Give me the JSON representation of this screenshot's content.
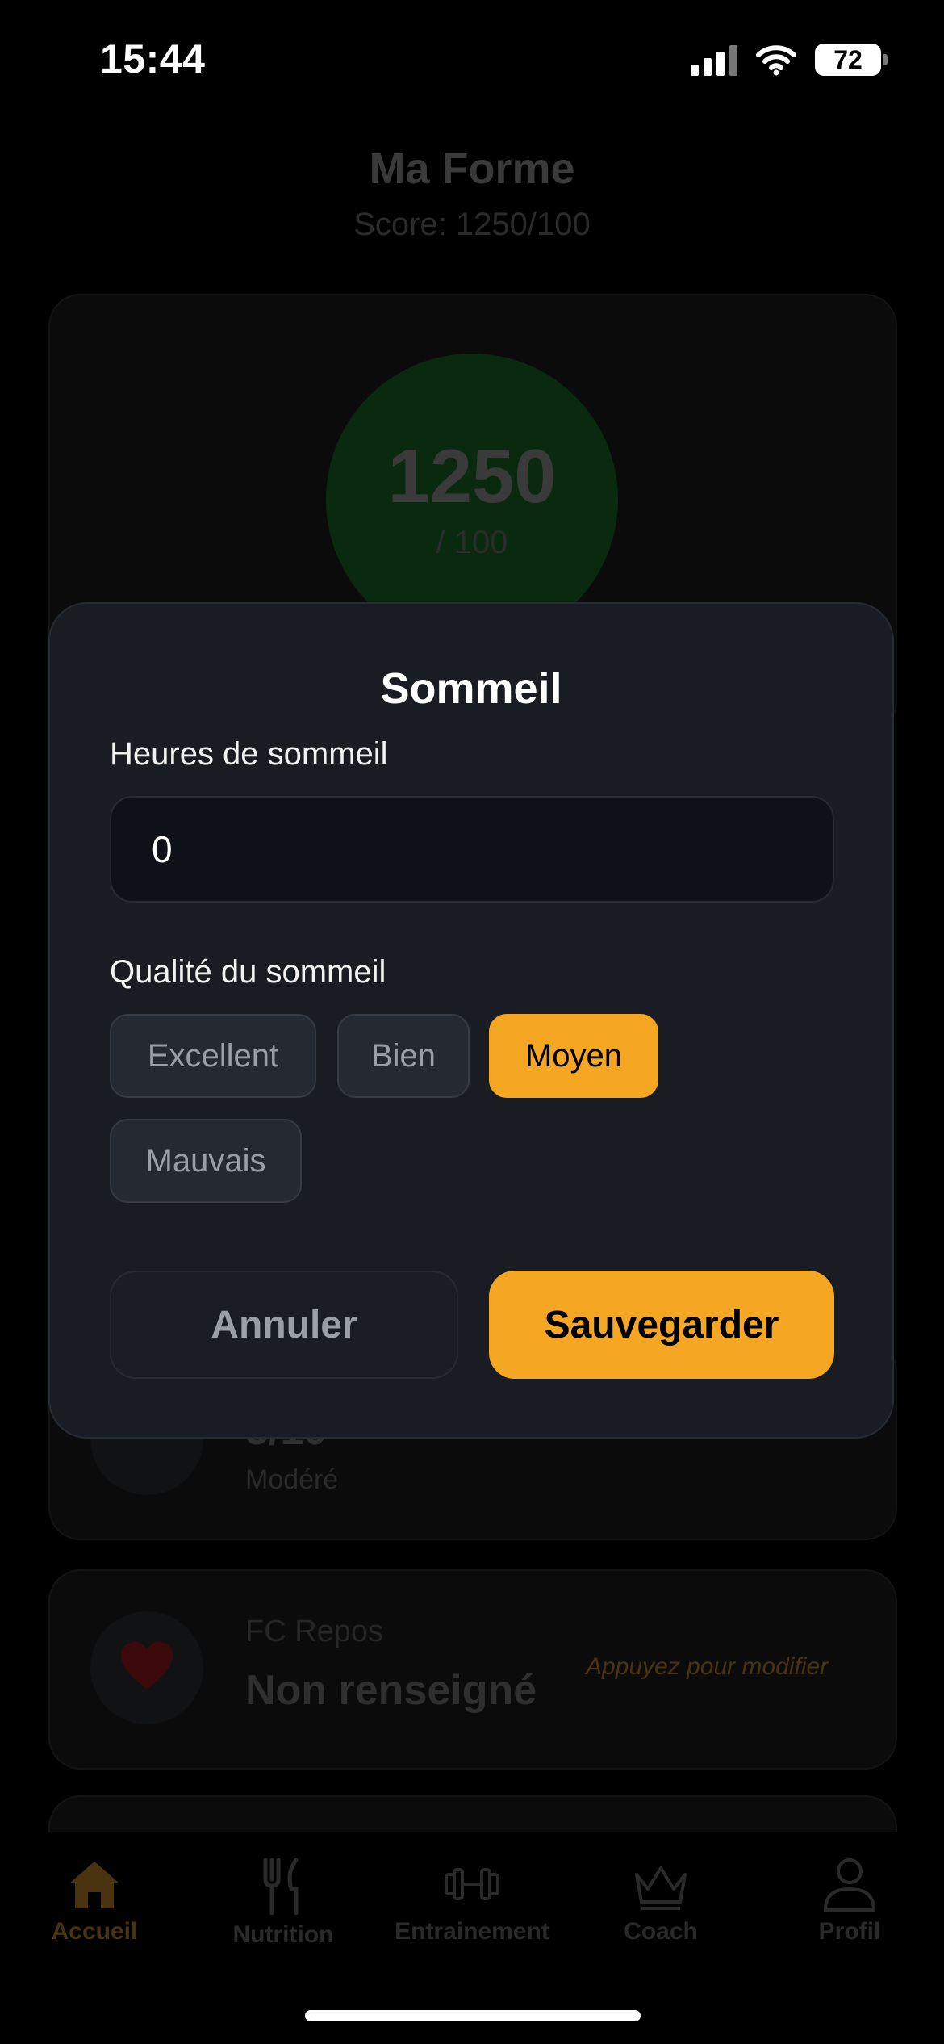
{
  "status_bar": {
    "time": "15:44",
    "battery": "72"
  },
  "page": {
    "title": "Ma Forme",
    "subtitle": "Score: 1250/100",
    "score": {
      "value": "1250",
      "denominator": "/ 100"
    },
    "stress_card": {
      "value": "5/10",
      "level": "Modéré"
    },
    "heart_card": {
      "label": "FC Repos",
      "value": "Non renseigné",
      "hint": "Appuyez pour modifier"
    }
  },
  "modal": {
    "title": "Sommeil",
    "hours_label": "Heures de sommeil",
    "hours_value": "0",
    "quality_label": "Qualité du sommeil",
    "quality_options": [
      "Excellent",
      "Bien",
      "Moyen",
      "Mauvais"
    ],
    "selected_quality": "Moyen",
    "cancel_label": "Annuler",
    "save_label": "Sauvegarder"
  },
  "tabs": [
    {
      "label": "Accueil",
      "icon": "home-icon",
      "active": true
    },
    {
      "label": "Nutrition",
      "icon": "fork-knife-icon",
      "active": false
    },
    {
      "label": "Entrainement",
      "icon": "dumbbell-icon",
      "active": false
    },
    {
      "label": "Coach",
      "icon": "crown-icon",
      "active": false
    },
    {
      "label": "Profil",
      "icon": "person-icon",
      "active": false
    }
  ],
  "colors": {
    "accent": "#f5a623",
    "modal_bg": "#191d23",
    "input_bg": "#0e1117"
  }
}
